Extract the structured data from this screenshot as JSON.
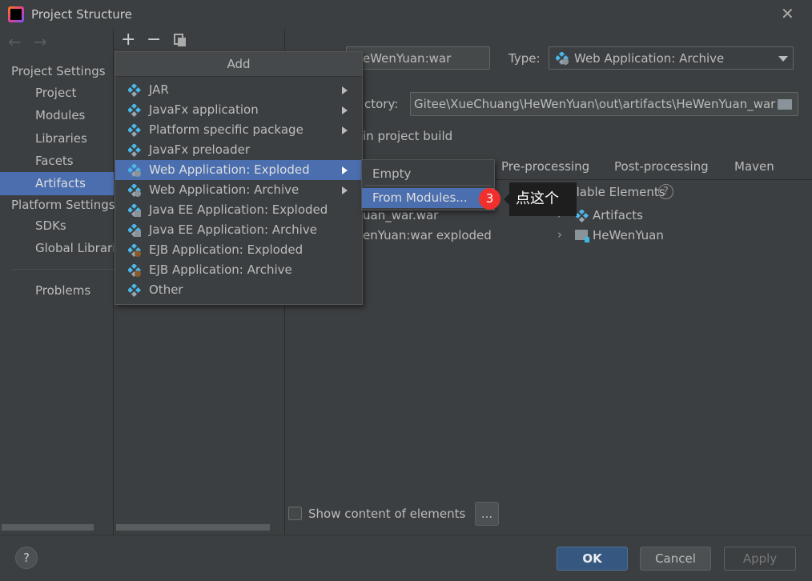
{
  "window": {
    "title": "Project Structure"
  },
  "sidebar": {
    "project_settings": "Project Settings",
    "items": [
      {
        "label": "Project"
      },
      {
        "label": "Modules"
      },
      {
        "label": "Libraries"
      },
      {
        "label": "Facets"
      },
      {
        "label": "Artifacts",
        "selected": true
      }
    ],
    "platform_settings": "Platform Settings",
    "platform_items": [
      {
        "label": "SDKs"
      },
      {
        "label": "Global Librari"
      }
    ],
    "problems": "Problems"
  },
  "add_menu": {
    "title": "Add",
    "items": [
      {
        "label": "JAR",
        "icon": "artifact-icon",
        "submenu": true
      },
      {
        "label": "JavaFx application",
        "icon": "artifact-icon",
        "submenu": true
      },
      {
        "label": "Platform specific package",
        "icon": "artifact-icon",
        "submenu": true
      },
      {
        "label": "JavaFx preloader",
        "icon": "artifact-icon",
        "submenu": false
      },
      {
        "label": "Web Application: Exploded",
        "icon": "web-artifact-icon",
        "submenu": true,
        "selected": true
      },
      {
        "label": "Web Application: Archive",
        "icon": "web-artifact-icon",
        "submenu": true
      },
      {
        "label": "Java EE Application: Exploded",
        "icon": "javaee-artifact-icon",
        "submenu": false
      },
      {
        "label": "Java EE Application: Archive",
        "icon": "javaee-artifact-icon",
        "submenu": false
      },
      {
        "label": "EJB Application: Exploded",
        "icon": "ejb-artifact-icon",
        "submenu": false
      },
      {
        "label": "EJB Application: Archive",
        "icon": "ejb-artifact-icon",
        "submenu": false
      },
      {
        "label": "Other",
        "icon": "artifact-icon",
        "submenu": false
      }
    ],
    "submenu": [
      {
        "label": "Empty"
      },
      {
        "label": "From Modules...",
        "selected": true
      }
    ]
  },
  "annotation": {
    "badge": "3",
    "tooltip": "点这个",
    "badge_color": "#f0302c"
  },
  "artifact": {
    "name": "eWenYuan:war",
    "type_label": "Type:",
    "type_value": "Web Application: Archive",
    "directory_label": "ctory:",
    "directory_value": "Gitee\\XueChuang\\HeWenYuan\\out\\artifacts\\HeWenYuan_war",
    "include_label": "in project build",
    "tabs": [
      "Pre-processing",
      "Post-processing",
      "Maven"
    ],
    "output_items": [
      "uan_war.war",
      "enYuan:war exploded"
    ],
    "available_label": "Available Elements",
    "available_items": [
      {
        "label": "Artifacts",
        "icon": "artifact-icon"
      },
      {
        "label": "HeWenYuan",
        "icon": "module-folder-icon"
      }
    ],
    "show_content_label": "Show content of elements",
    "show_content_checked": false,
    "more_button": "..."
  },
  "footer": {
    "ok": "OK",
    "cancel": "Cancel",
    "apply": "Apply",
    "help": "?"
  },
  "colors": {
    "accent": "#4b6eaf",
    "background": "#3c3f41",
    "ok_button": "#365880"
  }
}
